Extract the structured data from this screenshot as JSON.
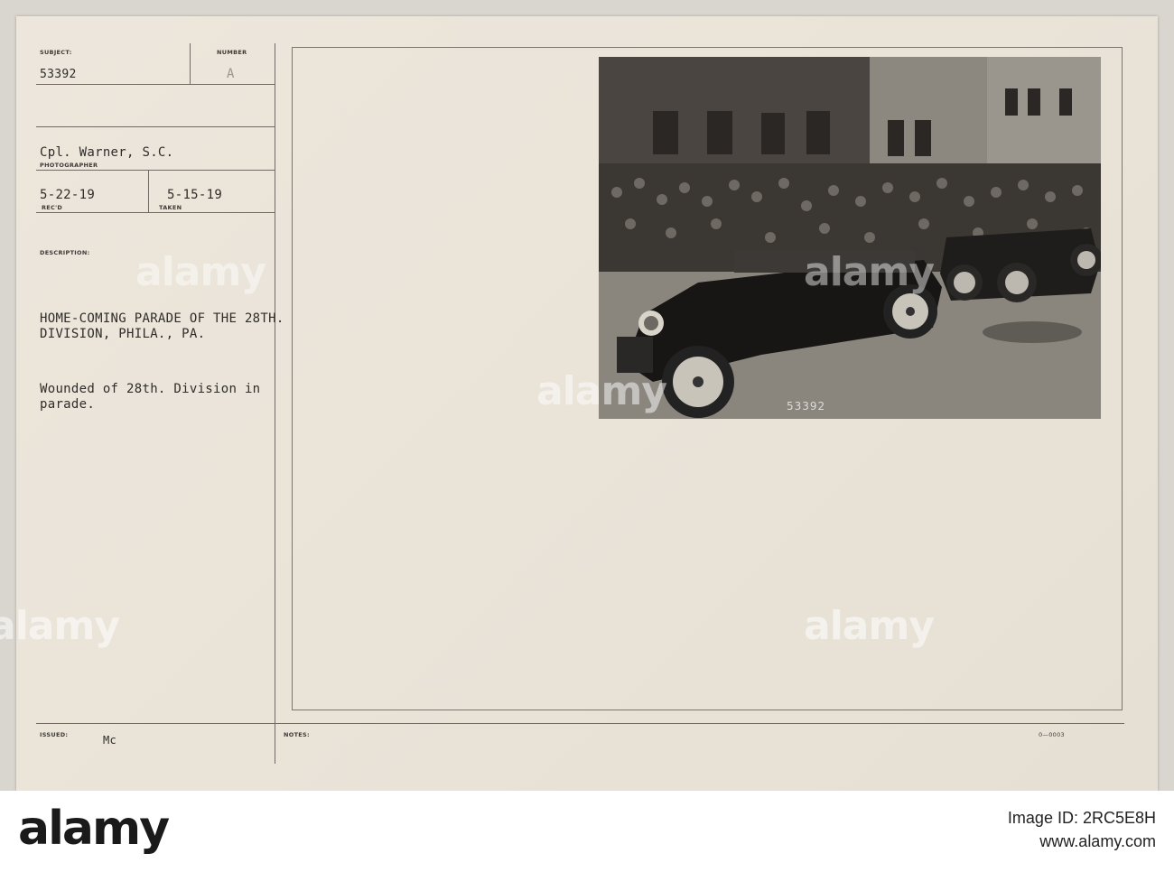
{
  "card": {
    "subject_label": "SUBJECT:",
    "subject_value": "53392",
    "number_label": "NUMBER",
    "number_value": "A",
    "photographer_value": "Cpl. Warner, S.C.",
    "photographer_label": "PHOTOGRAPHER",
    "recd_value": "5-22-19",
    "recd_label": "REC'D",
    "taken_value": "5-15-19",
    "taken_label": "TAKEN",
    "description_label": "DESCRIPTION:",
    "description_title_1": "HOME-COMING PARADE OF THE 28TH.",
    "description_title_2": "DIVISION, PHILA., PA.",
    "description_body_1": "Wounded of 28th. Division in",
    "description_body_2": "parade.",
    "issued_label": "ISSUED:",
    "issued_value": "Mc",
    "notes_label": "NOTES:",
    "form_code": "0—0003"
  },
  "photo": {
    "negative_number": "53392"
  },
  "watermark": {
    "brand": "alamy",
    "image_id": "Image ID: 2RC5E8H",
    "site": "www.alamy.com"
  }
}
